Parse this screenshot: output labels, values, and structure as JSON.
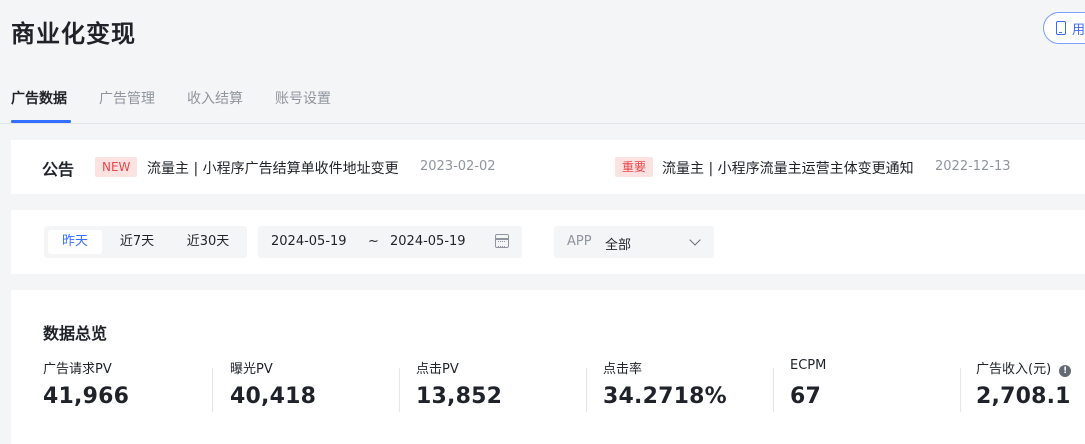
{
  "header": {
    "title": "商业化变现",
    "top_right_button_label": "用"
  },
  "tabs": [
    {
      "label": "广告数据",
      "active": true
    },
    {
      "label": "广告管理",
      "active": false
    },
    {
      "label": "收入结算",
      "active": false
    },
    {
      "label": "账号设置",
      "active": false
    }
  ],
  "notice": {
    "label": "公告",
    "items": [
      {
        "badge": "NEW",
        "text": "流量主 | 小程序广告结算单收件地址变更",
        "date": "2023-02-02"
      },
      {
        "badge": "重要",
        "text": "流量主 | 小程序流量主运营主体变更通知",
        "date": "2022-12-13"
      }
    ]
  },
  "filter": {
    "ranges": [
      {
        "label": "昨天",
        "active": true
      },
      {
        "label": "近7天",
        "active": false
      },
      {
        "label": "近30天",
        "active": false
      }
    ],
    "date_start": "2024-05-19",
    "date_sep": "~",
    "date_end": "2024-05-19",
    "app_label": "APP",
    "app_value": "全部"
  },
  "overview": {
    "title": "数据总览",
    "metrics": [
      {
        "label": "广告请求PV",
        "value": "41,966"
      },
      {
        "label": "曝光PV",
        "value": "40,418"
      },
      {
        "label": "点击PV",
        "value": "13,852"
      },
      {
        "label": "点击率",
        "value": "34.2718%"
      },
      {
        "label": "ECPM",
        "value": "67"
      },
      {
        "label": "广告收入(元)",
        "value": "2,708.1",
        "info_icon": "info-icon"
      }
    ]
  },
  "colors": {
    "accent": "#3370ff",
    "badge_red": "#e8474b",
    "badge_bg": "#fde2e2"
  }
}
